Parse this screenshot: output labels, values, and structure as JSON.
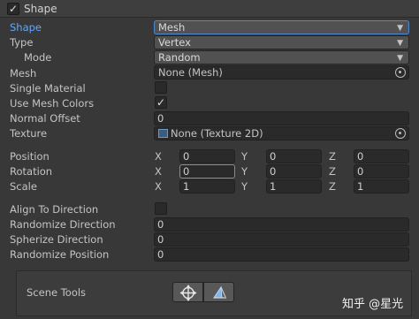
{
  "header": {
    "title": "Shape",
    "checked": "✓"
  },
  "fields": {
    "shape": {
      "label": "Shape",
      "value": "Mesh"
    },
    "type": {
      "label": "Type",
      "value": "Vertex"
    },
    "mode": {
      "label": "Mode",
      "value": "Random"
    },
    "mesh": {
      "label": "Mesh",
      "value": "None (Mesh)"
    },
    "single_material": {
      "label": "Single Material",
      "checked": ""
    },
    "use_mesh_colors": {
      "label": "Use Mesh Colors",
      "checked": "✓"
    },
    "normal_offset": {
      "label": "Normal Offset",
      "value": "0"
    },
    "texture": {
      "label": "Texture",
      "value": "None (Texture 2D)"
    },
    "position": {
      "label": "Position",
      "x": "0",
      "y": "0",
      "z": "0"
    },
    "rotation": {
      "label": "Rotation",
      "x": "0",
      "y": "0",
      "z": "0"
    },
    "scale": {
      "label": "Scale",
      "x": "1",
      "y": "1",
      "z": "1"
    },
    "align_to_direction": {
      "label": "Align To Direction",
      "checked": ""
    },
    "randomize_direction": {
      "label": "Randomize Direction",
      "value": "0"
    },
    "spherize_direction": {
      "label": "Spherize Direction",
      "value": "0"
    },
    "randomize_position": {
      "label": "Randomize Position",
      "value": "0"
    }
  },
  "axes": {
    "x": "X",
    "y": "Y",
    "z": "Z"
  },
  "scene_tools": {
    "label": "Scene Tools"
  },
  "watermark": "知乎 @星光",
  "colors": {
    "accent": "#5fa8ff",
    "background": "#383838",
    "field": "#2a2a2a"
  }
}
